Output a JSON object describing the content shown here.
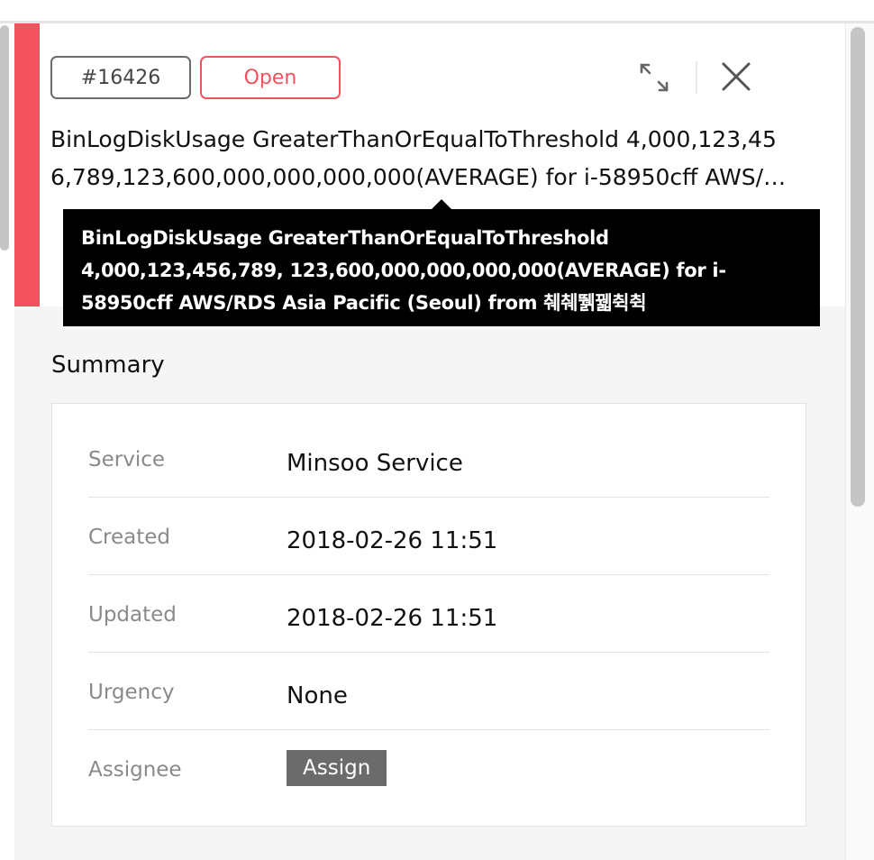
{
  "incident": {
    "id_label": "#16426",
    "status_label": "Open",
    "title": "BinLogDiskUsage  GreaterThanOrEqualToThreshold  4,000,123,456,789,123,600,000,000,000,000(AVERAGE) for i-58950cff AWS/RDS Asia Pacific (Seoul) from 췌췌뛝꿻췩췩",
    "tooltip": "BinLogDiskUsage GreaterThanOrEqualToThreshold 4,000,123,456,789, 123,600,000,000,000,000(AVERAGE) for i-58950cff AWS/RDS Asia Pacific (Seoul) from 췌췌뛝꿻췩췩"
  },
  "actions": {
    "expand_icon": "expand-icon",
    "close_icon": "close-icon"
  },
  "summary": {
    "heading": "Summary",
    "rows": [
      {
        "label": "Service",
        "value": "Minsoo Service"
      },
      {
        "label": "Created",
        "value": "2018-02-26 11:51"
      },
      {
        "label": "Updated",
        "value": "2018-02-26 11:51"
      },
      {
        "label": "Urgency",
        "value": "None"
      },
      {
        "label": "Assignee",
        "button": "Assign"
      }
    ]
  },
  "colors": {
    "accent": "#f4515e",
    "neutral_button": "#6b6b6b",
    "tooltip_bg": "#000000"
  }
}
